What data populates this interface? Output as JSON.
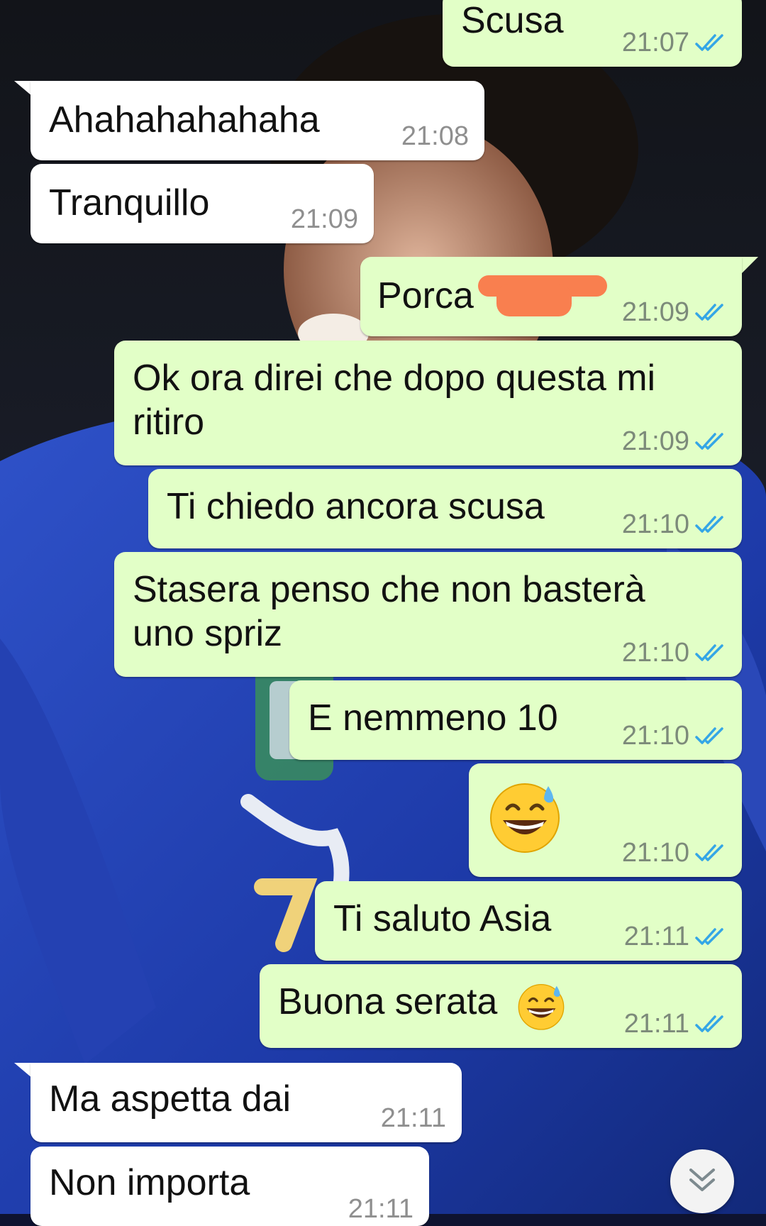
{
  "messages": [
    {
      "dir": "out",
      "text": "Scusa",
      "time": "21:07",
      "read": true
    },
    {
      "dir": "in",
      "text": "Ahahahahahaha",
      "time": "21:08"
    },
    {
      "dir": "in",
      "text": "Tranquillo",
      "time": "21:09"
    },
    {
      "dir": "out",
      "text": "Porca",
      "time": "21:09",
      "read": true,
      "redacted": true
    },
    {
      "dir": "out",
      "text_line1": "Ok ora direi che dopo questa mi",
      "text_line2": "ritiro",
      "time": "21:09",
      "read": true
    },
    {
      "dir": "out",
      "text": "Ti chiedo ancora scusa",
      "time": "21:10",
      "read": true
    },
    {
      "dir": "out",
      "text_line1": "Stasera penso che non basterà",
      "text_line2": "uno spriz",
      "time": "21:10",
      "read": true
    },
    {
      "dir": "out",
      "text": "E nemmeno 10",
      "time": "21:10",
      "read": true
    },
    {
      "dir": "out",
      "emoji": "grinning-face-with-sweat",
      "time": "21:10",
      "read": true
    },
    {
      "dir": "out",
      "text": "Ti saluto Asia",
      "time": "21:11",
      "read": true
    },
    {
      "dir": "out",
      "text": "Buona serata",
      "emoji": "grinning-face-with-sweat",
      "time": "21:11",
      "read": true
    },
    {
      "dir": "in",
      "text": "Ma aspetta dai",
      "time": "21:11"
    },
    {
      "dir": "in",
      "text": "Non importa",
      "time": "21:11"
    }
  ],
  "colors": {
    "outgoing_bubble": "#e2ffc7",
    "incoming_bubble": "#ffffff",
    "read_check": "#34a6e6",
    "timestamp": "#7c8a7a",
    "redaction": "#f97f4f"
  },
  "scroll_button": {
    "icon": "double-chevron-down-icon"
  }
}
